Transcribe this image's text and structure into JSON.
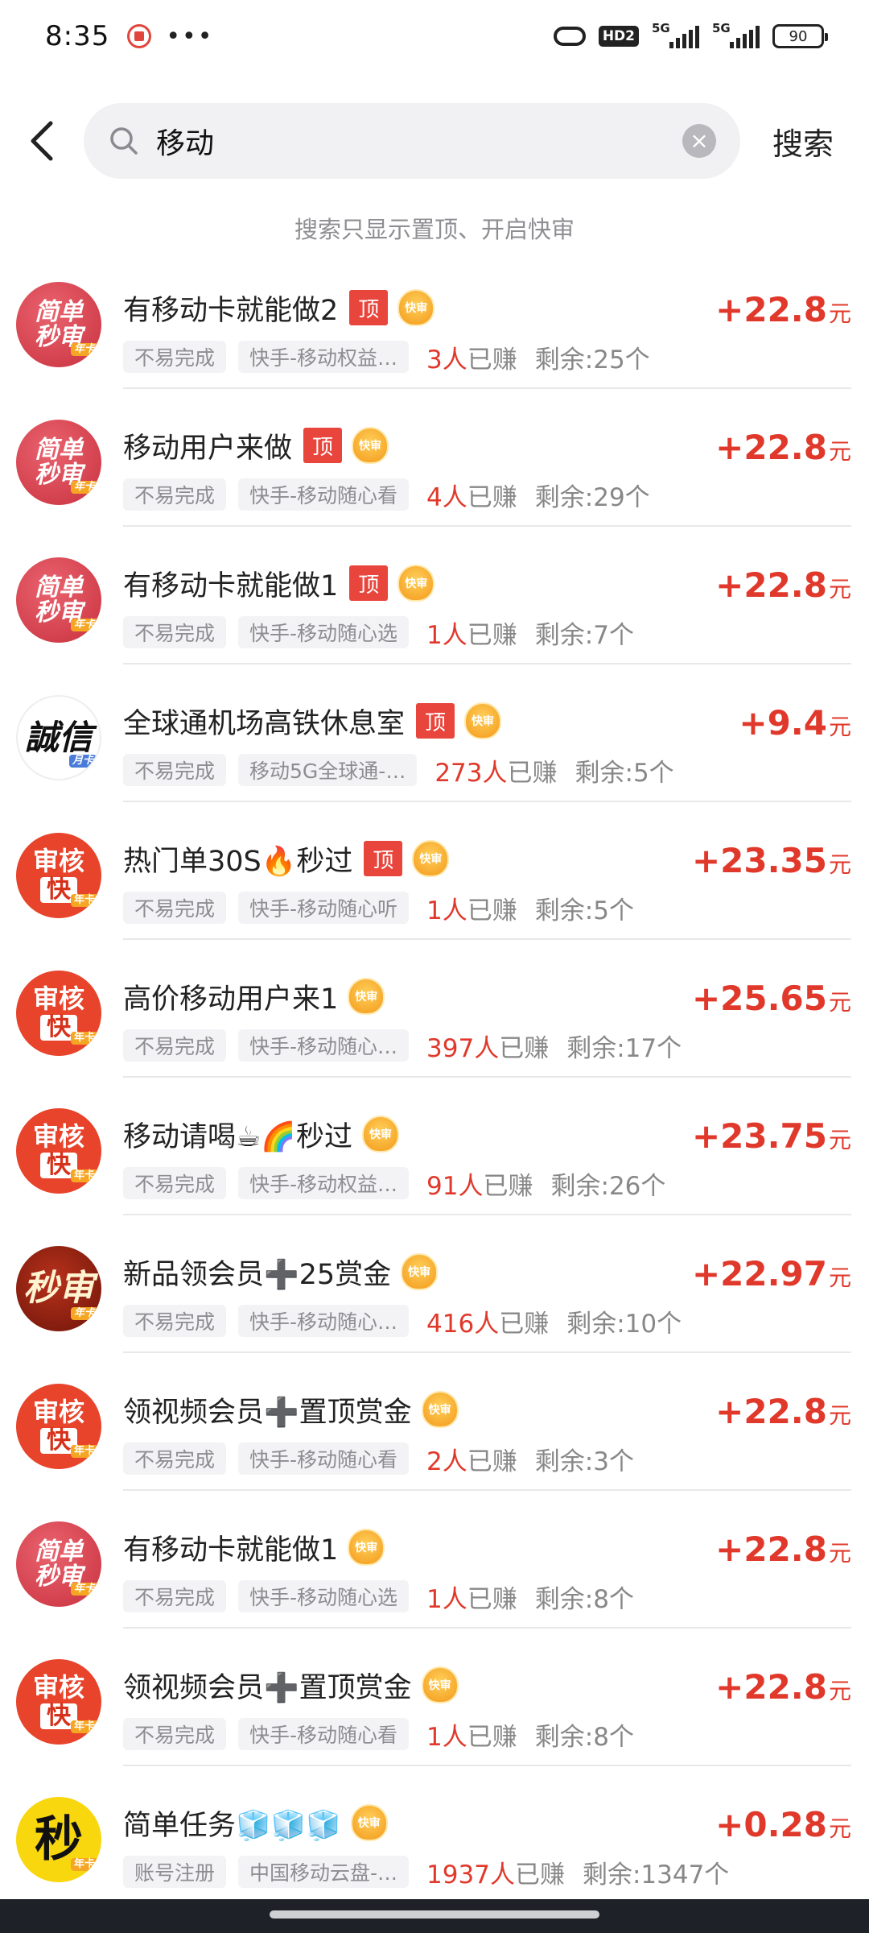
{
  "status_bar": {
    "time": "8:35",
    "dots": "•••",
    "hd": "HD2",
    "net1": "5G",
    "net2": "5G",
    "battery": "90"
  },
  "search": {
    "query": "移动",
    "button_label": "搜索",
    "hint": "搜索只显示置顶、开启快审"
  },
  "badges": {
    "top_label": "顶",
    "fast_label": "快审"
  },
  "avatars": {
    "simple": {
      "line1": "简单",
      "line2": "秒审",
      "tag": "年卡"
    },
    "review": {
      "line1": "审核",
      "line2": "快",
      "tag": "年卡"
    },
    "chengxin": {
      "line1": "誠信",
      "tag": "月卡"
    },
    "miao": {
      "line1": "秒审",
      "tag": "年卡"
    },
    "yellow": {
      "line1": "秒",
      "tag": "年卡"
    }
  },
  "tasks": [
    {
      "avatar": "simple",
      "title": "有移动卡就能做2",
      "top": true,
      "fast": true,
      "difficulty": "不易完成",
      "category": "快手-移动权益…",
      "earned_count": "3人",
      "earned_label": "已赚",
      "remaining": "剩余:25个",
      "price": "+22.8",
      "unit": "元"
    },
    {
      "avatar": "simple",
      "title": "移动用户来做",
      "top": true,
      "fast": true,
      "difficulty": "不易完成",
      "category": "快手-移动随心看",
      "earned_count": "4人",
      "earned_label": "已赚",
      "remaining": "剩余:29个",
      "price": "+22.8",
      "unit": "元"
    },
    {
      "avatar": "simple",
      "title": "有移动卡就能做1",
      "top": true,
      "fast": true,
      "difficulty": "不易完成",
      "category": "快手-移动随心选",
      "earned_count": "1人",
      "earned_label": "已赚",
      "remaining": "剩余:7个",
      "price": "+22.8",
      "unit": "元"
    },
    {
      "avatar": "chengxin",
      "title": "全球通机场高铁休息室",
      "top": true,
      "fast": true,
      "difficulty": "不易完成",
      "category": "移动5G全球通-…",
      "earned_count": "273人",
      "earned_label": "已赚",
      "remaining": "剩余:5个",
      "price": "+9.4",
      "unit": "元"
    },
    {
      "avatar": "review",
      "title": "热门单30S🔥秒过",
      "top": true,
      "fast": true,
      "difficulty": "不易完成",
      "category": "快手-移动随心听",
      "earned_count": "1人",
      "earned_label": "已赚",
      "remaining": "剩余:5个",
      "price": "+23.35",
      "unit": "元"
    },
    {
      "avatar": "review",
      "title": "高价移动用户来1",
      "top": false,
      "fast": true,
      "difficulty": "不易完成",
      "category": "快手-移动随心…",
      "earned_count": "397人",
      "earned_label": "已赚",
      "remaining": "剩余:17个",
      "price": "+25.65",
      "unit": "元"
    },
    {
      "avatar": "review",
      "title": "移动请喝☕🌈秒过",
      "top": false,
      "fast": true,
      "difficulty": "不易完成",
      "category": "快手-移动权益…",
      "earned_count": "91人",
      "earned_label": "已赚",
      "remaining": "剩余:26个",
      "price": "+23.75",
      "unit": "元"
    },
    {
      "avatar": "miao",
      "title": "新品领会员➕25赏金",
      "top": false,
      "fast": true,
      "difficulty": "不易完成",
      "category": "快手-移动随心…",
      "earned_count": "416人",
      "earned_label": "已赚",
      "remaining": "剩余:10个",
      "price": "+22.97",
      "unit": "元"
    },
    {
      "avatar": "review",
      "title": "领视频会员➕置顶赏金",
      "top": false,
      "fast": true,
      "difficulty": "不易完成",
      "category": "快手-移动随心看",
      "earned_count": "2人",
      "earned_label": "已赚",
      "remaining": "剩余:3个",
      "price": "+22.8",
      "unit": "元"
    },
    {
      "avatar": "simple",
      "title": "有移动卡就能做1",
      "top": false,
      "fast": true,
      "difficulty": "不易完成",
      "category": "快手-移动随心选",
      "earned_count": "1人",
      "earned_label": "已赚",
      "remaining": "剩余:8个",
      "price": "+22.8",
      "unit": "元"
    },
    {
      "avatar": "review",
      "title": "领视频会员➕置顶赏金",
      "top": false,
      "fast": true,
      "difficulty": "不易完成",
      "category": "快手-移动随心看",
      "earned_count": "1人",
      "earned_label": "已赚",
      "remaining": "剩余:8个",
      "price": "+22.8",
      "unit": "元"
    },
    {
      "avatar": "yellow",
      "title": "简单任务🧊🧊🧊",
      "top": false,
      "fast": true,
      "difficulty": "账号注册",
      "category": "中国移动云盘-…",
      "earned_count": "1937人",
      "earned_label": "已赚",
      "remaining": "剩余:1347个",
      "price": "+0.28",
      "unit": "元"
    }
  ]
}
